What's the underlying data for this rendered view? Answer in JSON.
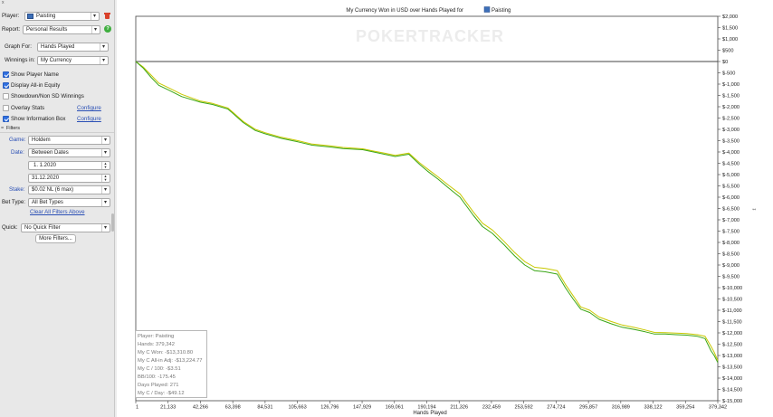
{
  "sidebar": {
    "top_mark": "x",
    "player_label": "Player:",
    "player_value": "Paisting",
    "report_label": "Report:",
    "report_value": "Personal Results",
    "graph_for_label": "Graph For:",
    "graph_for_value": "Hands Played",
    "winnings_in_label": "Winnings in:",
    "winnings_in_value": "My Currency",
    "show_player_name": "Show Player Name",
    "display_allin_equity": "Display All-in Equity",
    "showdown_non_sd": "Showdown/Non SD Winnings",
    "overlay_stats": "Overlay Stats",
    "show_info_box": "Show Information Box",
    "configure": "Configure",
    "filters_label": "Filters",
    "filters_toggle": "=",
    "game_label": "Game:",
    "game_value": "Holdem",
    "date_label": "Date:",
    "date_value": "Between Dates",
    "date_from": "1.  1.2020",
    "date_to": "31.12.2020",
    "stake_label": "Stake:",
    "stake_value": "$0.02 NL (6 max)",
    "bet_type_label": "Bet Type:",
    "bet_type_value": "All Bet Types",
    "clear_filters": "Clear All Filters Above",
    "quick_label": "Quick:",
    "quick_value": "No Quick Filter",
    "more_filters": "More Filters...",
    "checkboxes": {
      "show_player_name": true,
      "display_allin_equity": true,
      "showdown_non_sd": false,
      "overlay_stats": false,
      "show_info_box": true
    },
    "colors": {
      "checkbox_blue": "#2f6fe0",
      "link_blue": "#2a4fb5",
      "help_green": "#3fae3f",
      "trash_red": "#d9412b"
    }
  },
  "chart": {
    "watermark": "POKERTRACKER",
    "title_prefix": "My Currency Won in USD over Hands Played for",
    "title_player": "Paisting",
    "colors": {
      "won_line": "#3aa616",
      "allin_line": "#c8c800",
      "zero_line": "#444444"
    }
  },
  "info_box": {
    "lines": [
      "Player: Paisting",
      "Hands: 379,342",
      "My C Won: -$13,310.80",
      "My C All-in Adj: -$13,224.77",
      "My C / 100: -$3.51",
      "BB/100: -175.45",
      "Days Played: 271",
      "My C / Day: -$49.12"
    ]
  },
  "chart_data": {
    "type": "line",
    "title": "My Currency Won in USD over Hands Played for Paisting",
    "xlabel": "Hands Played",
    "ylabel": "",
    "x_tick_labels": [
      "1",
      "21,133",
      "42,266",
      "63,398",
      "84,531",
      "105,663",
      "126,796",
      "147,929",
      "169,061",
      "190,194",
      "211,326",
      "232,459",
      "253,592",
      "274,724",
      "295,857",
      "316,989",
      "338,122",
      "359,254",
      "379,342"
    ],
    "y_tick_labels": [
      "$2,000",
      "$1,500",
      "$1,000",
      "$500",
      "$0",
      "$-500",
      "$-1,000",
      "$-1,500",
      "$-2,000",
      "$-2,500",
      "$-3,000",
      "$-3,500",
      "$-4,000",
      "$-4,500",
      "$-5,000",
      "$-5,500",
      "$-6,000",
      "$-6,500",
      "$-7,000",
      "$-7,500",
      "$-8,000",
      "$-8,500",
      "$-9,000",
      "$-9,500",
      "$-10,000",
      "$-10,500",
      "$-11,000",
      "$-11,500",
      "$-12,000",
      "$-12,500",
      "$-13,000",
      "$-13,500",
      "$-14,000",
      "$-14,500",
      "$-15,000"
    ],
    "xlim": [
      1,
      379342
    ],
    "ylim": [
      -15000,
      2000
    ],
    "grid": false,
    "series": [
      {
        "key": "won",
        "x": [
          1,
          5000,
          10000,
          15000,
          21133,
          30000,
          42266,
          50000,
          60000,
          63398,
          70000,
          78000,
          84531,
          95000,
          105663,
          115000,
          126796,
          135000,
          147929,
          155000,
          162000,
          169061,
          178000,
          185000,
          190194,
          197000,
          204000,
          211326,
          220000,
          226000,
          232459,
          240000,
          247000,
          253592,
          260000,
          267000,
          274724,
          280000,
          285000,
          290000,
          295857,
          302000,
          310000,
          316989,
          325000,
          332000,
          338122,
          345000,
          352000,
          359254,
          366000,
          371000,
          375000,
          377000,
          379342
        ],
        "y": [
          0,
          -300,
          -700,
          -1050,
          -1250,
          -1550,
          -1800,
          -1900,
          -2100,
          -2300,
          -2700,
          -3050,
          -3200,
          -3400,
          -3550,
          -3700,
          -3780,
          -3850,
          -3900,
          -4000,
          -4100,
          -4200,
          -4100,
          -4550,
          -4850,
          -5200,
          -5600,
          -6000,
          -6800,
          -7300,
          -7600,
          -8100,
          -8600,
          -9000,
          -9250,
          -9300,
          -9400,
          -10000,
          -10500,
          -10950,
          -11100,
          -11400,
          -11600,
          -11750,
          -11850,
          -11950,
          -12050,
          -12050,
          -12080,
          -12100,
          -12150,
          -12250,
          -12800,
          -13000,
          -13310.8
        ]
      },
      {
        "key": "allin",
        "x": [
          1,
          5000,
          10000,
          15000,
          21133,
          30000,
          42266,
          50000,
          60000,
          63398,
          70000,
          78000,
          84531,
          95000,
          105663,
          115000,
          126796,
          135000,
          147929,
          155000,
          162000,
          169061,
          178000,
          185000,
          190194,
          197000,
          204000,
          211326,
          220000,
          226000,
          232459,
          240000,
          247000,
          253592,
          260000,
          267000,
          274724,
          280000,
          285000,
          290000,
          295857,
          302000,
          310000,
          316989,
          325000,
          332000,
          338122,
          345000,
          352000,
          359254,
          366000,
          371000,
          375000,
          377000,
          379342
        ],
        "y": [
          0,
          -250,
          -600,
          -950,
          -1150,
          -1450,
          -1750,
          -1850,
          -2050,
          -2250,
          -2650,
          -3000,
          -3150,
          -3350,
          -3500,
          -3650,
          -3730,
          -3800,
          -3860,
          -3960,
          -4050,
          -4150,
          -4050,
          -4480,
          -4750,
          -5100,
          -5480,
          -5850,
          -6650,
          -7150,
          -7450,
          -7950,
          -8450,
          -8850,
          -9100,
          -9150,
          -9250,
          -9850,
          -10350,
          -10850,
          -11000,
          -11300,
          -11500,
          -11650,
          -11760,
          -11870,
          -11980,
          -11990,
          -12010,
          -12030,
          -12080,
          -12150,
          -12600,
          -12850,
          -13224.77
        ]
      }
    ]
  }
}
